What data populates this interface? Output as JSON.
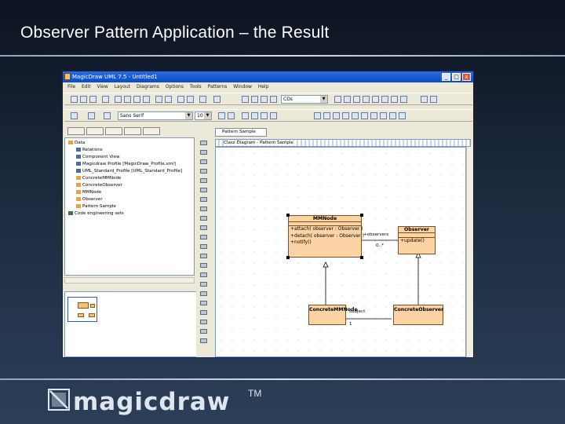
{
  "slide": {
    "title": "Observer Pattern Application – the Result"
  },
  "window": {
    "title": "MagicDraw UML 7.5 - Untitled1",
    "buttons": {
      "minimize": "_",
      "maximize": "□",
      "close": "x"
    }
  },
  "menubar": [
    "File",
    "Edit",
    "View",
    "Layout",
    "Diagrams",
    "Options",
    "Tools",
    "Patterns",
    "Window",
    "Help"
  ],
  "toolbar": {
    "zoom_value": "CDs",
    "font_combo": "Sans Serif",
    "font_size": "10"
  },
  "browser": {
    "rows": [
      {
        "label": "Data",
        "color": "#e6a43a"
      },
      {
        "label": "Relations",
        "color": "#4a6aa8"
      },
      {
        "label": "Component View",
        "color": "#4a6aa8"
      },
      {
        "label": "Magicdraw Profile [MagicDraw_Profile.xml]",
        "color": "#4a6aa8"
      },
      {
        "label": "UML_Standard_Profile [UML_Standard_Profile]",
        "color": "#4a6aa8"
      },
      {
        "label": "ConcreteMMNode",
        "color": "#e6a43a"
      },
      {
        "label": "ConcreteObserver",
        "color": "#e6a43a"
      },
      {
        "label": "MMNode",
        "color": "#e6a43a"
      },
      {
        "label": "Observer",
        "color": "#e6a43a"
      },
      {
        "label": "Pattern Sample",
        "color": "#e6a43a"
      },
      {
        "label": "Code engineering sets",
        "color": "#3a7a3a"
      }
    ]
  },
  "diagram": {
    "tab_label": "Pattern Sample",
    "header_label": "Class Diagram - Pattern Sample",
    "classes": {
      "mmnode": {
        "name": "MMNode",
        "ops": [
          "+attach( observer : Observer )",
          "+detach( observer : Observer )",
          "+notify()"
        ]
      },
      "observer": {
        "name": "Observer",
        "ops": [
          "+update()"
        ]
      },
      "concrete_mmnode": {
        "name": "ConcreteMMNode"
      },
      "concrete_observer": {
        "name": "ConcreteObserver"
      }
    },
    "association": {
      "role": "+observers",
      "multiplicity": "0..*"
    },
    "subject": {
      "label": "subject",
      "multiplicity": "1"
    }
  },
  "logo": {
    "text": "magicdraw",
    "tm": "TM"
  },
  "colors": {
    "class_fill": "#fbd3a4",
    "titlebar": "#0a4cc8"
  }
}
